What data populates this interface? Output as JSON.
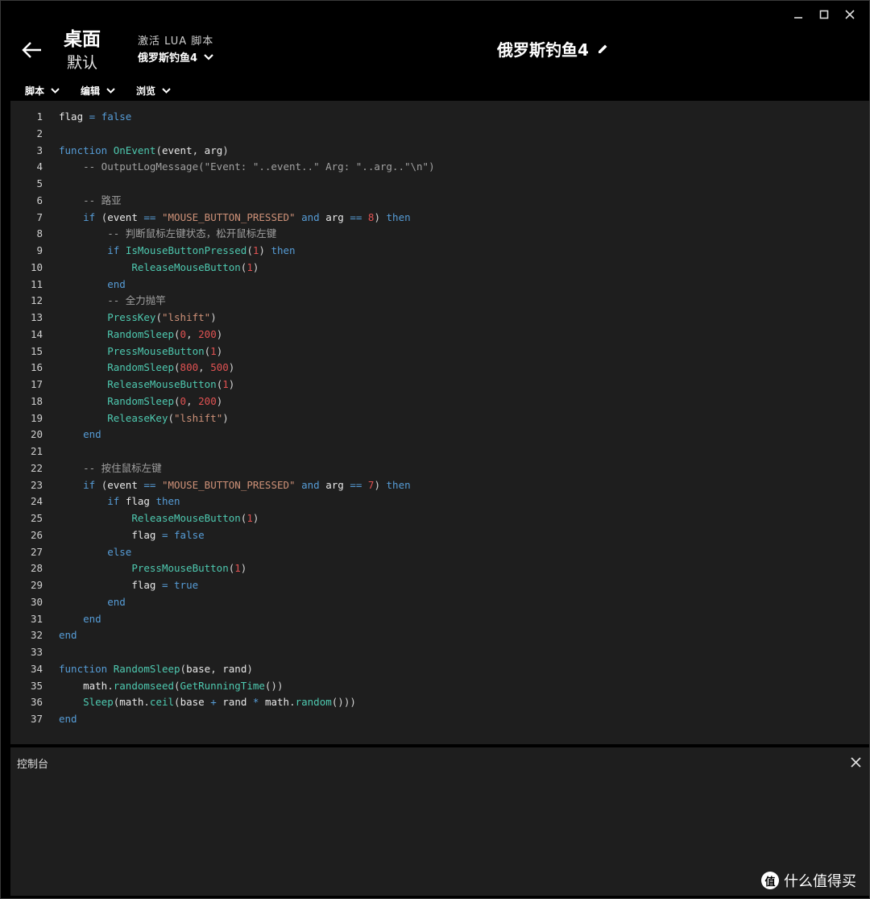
{
  "header": {
    "desktop_title": "桌面",
    "desktop_sub": "默认",
    "activate_label": "激活 LUA 脚本",
    "profile_name": "俄罗斯钓鱼4",
    "script_title": "俄罗斯钓鱼4"
  },
  "menubar": [
    {
      "label": "脚本"
    },
    {
      "label": "编辑"
    },
    {
      "label": "浏览"
    }
  ],
  "console": {
    "label": "控制台"
  },
  "watermark": {
    "text": "什么值得买",
    "logo": "值"
  },
  "code_lines": [
    {
      "n": "1",
      "html": "<span class=\"var\">flag</span> <span class=\"op\">=</span> <span class=\"kw\">false</span>"
    },
    {
      "n": "2",
      "html": ""
    },
    {
      "n": "3",
      "html": "<span class=\"kw\">function</span> <span class=\"fn\">OnEvent</span>(<span class=\"var\">event</span>, <span class=\"var\">arg</span>)"
    },
    {
      "n": "4",
      "html": "    <span class=\"cm\">-- OutputLogMessage(\"Event: \"..event..\" Arg: \"..arg..\"\\n\")</span>"
    },
    {
      "n": "5",
      "html": ""
    },
    {
      "n": "6",
      "html": "    <span class=\"cm\">-- 路亚</span>"
    },
    {
      "n": "7",
      "html": "    <span class=\"kw\">if</span> (<span class=\"var\">event</span> <span class=\"op\">==</span> <span class=\"str\">\"MOUSE_BUTTON_PRESSED\"</span> <span class=\"kw\">and</span> <span class=\"var\">arg</span> <span class=\"op\">==</span> <span class=\"num\">8</span>) <span class=\"kw\">then</span>"
    },
    {
      "n": "8",
      "html": "        <span class=\"cm\">-- 判断鼠标左键状态，松开鼠标左键</span>"
    },
    {
      "n": "9",
      "html": "        <span class=\"kw\">if</span> <span class=\"fn\">IsMouseButtonPressed</span>(<span class=\"num\">1</span>) <span class=\"kw\">then</span>"
    },
    {
      "n": "10",
      "html": "            <span class=\"fn\">ReleaseMouseButton</span>(<span class=\"num\">1</span>)"
    },
    {
      "n": "11",
      "html": "        <span class=\"kw\">end</span>"
    },
    {
      "n": "12",
      "html": "        <span class=\"cm\">-- 全力抛竿</span>"
    },
    {
      "n": "13",
      "html": "        <span class=\"fn\">PressKey</span>(<span class=\"str\">\"lshift\"</span>)"
    },
    {
      "n": "14",
      "html": "        <span class=\"fn\">RandomSleep</span>(<span class=\"num\">0</span>, <span class=\"num\">200</span>)"
    },
    {
      "n": "15",
      "html": "        <span class=\"fn\">PressMouseButton</span>(<span class=\"num\">1</span>)"
    },
    {
      "n": "16",
      "html": "        <span class=\"fn\">RandomSleep</span>(<span class=\"num\">800</span>, <span class=\"num\">500</span>)"
    },
    {
      "n": "17",
      "html": "        <span class=\"fn\">ReleaseMouseButton</span>(<span class=\"num\">1</span>)"
    },
    {
      "n": "18",
      "html": "        <span class=\"fn\">RandomSleep</span>(<span class=\"num\">0</span>, <span class=\"num\">200</span>)"
    },
    {
      "n": "19",
      "html": "        <span class=\"fn\">ReleaseKey</span>(<span class=\"str\">\"lshift\"</span>)"
    },
    {
      "n": "20",
      "html": "    <span class=\"kw\">end</span>"
    },
    {
      "n": "21",
      "html": ""
    },
    {
      "n": "22",
      "html": "    <span class=\"cm\">-- 按住鼠标左键</span>"
    },
    {
      "n": "23",
      "html": "    <span class=\"kw\">if</span> (<span class=\"var\">event</span> <span class=\"op\">==</span> <span class=\"str\">\"MOUSE_BUTTON_PRESSED\"</span> <span class=\"kw\">and</span> <span class=\"var\">arg</span> <span class=\"op\">==</span> <span class=\"num\">7</span>) <span class=\"kw\">then</span>"
    },
    {
      "n": "24",
      "html": "        <span class=\"kw\">if</span> <span class=\"var\">flag</span> <span class=\"kw\">then</span>"
    },
    {
      "n": "25",
      "html": "            <span class=\"fn\">ReleaseMouseButton</span>(<span class=\"num\">1</span>)"
    },
    {
      "n": "26",
      "html": "            <span class=\"var\">flag</span> <span class=\"op\">=</span> <span class=\"kw\">false</span>"
    },
    {
      "n": "27",
      "html": "        <span class=\"kw\">else</span>"
    },
    {
      "n": "28",
      "html": "            <span class=\"fn\">PressMouseButton</span>(<span class=\"num\">1</span>)"
    },
    {
      "n": "29",
      "html": "            <span class=\"var\">flag</span> <span class=\"op\">=</span> <span class=\"kw\">true</span>"
    },
    {
      "n": "30",
      "html": "        <span class=\"kw\">end</span>"
    },
    {
      "n": "31",
      "html": "    <span class=\"kw\">end</span>"
    },
    {
      "n": "32",
      "html": "<span class=\"kw\">end</span>"
    },
    {
      "n": "33",
      "html": ""
    },
    {
      "n": "34",
      "html": "<span class=\"kw\">function</span> <span class=\"fn\">RandomSleep</span>(<span class=\"var\">base</span>, <span class=\"var\">rand</span>)"
    },
    {
      "n": "35",
      "html": "    <span class=\"var\">math</span>.<span class=\"fn\">randomseed</span>(<span class=\"fn\">GetRunningTime</span>())"
    },
    {
      "n": "36",
      "html": "    <span class=\"fn\">Sleep</span>(<span class=\"var\">math</span>.<span class=\"fn\">ceil</span>(<span class=\"var\">base</span> <span class=\"op\">+</span> <span class=\"var\">rand</span> <span class=\"op\">*</span> <span class=\"var\">math</span>.<span class=\"fn\">random</span>()))"
    },
    {
      "n": "37",
      "html": "<span class=\"kw\">end</span>"
    }
  ]
}
